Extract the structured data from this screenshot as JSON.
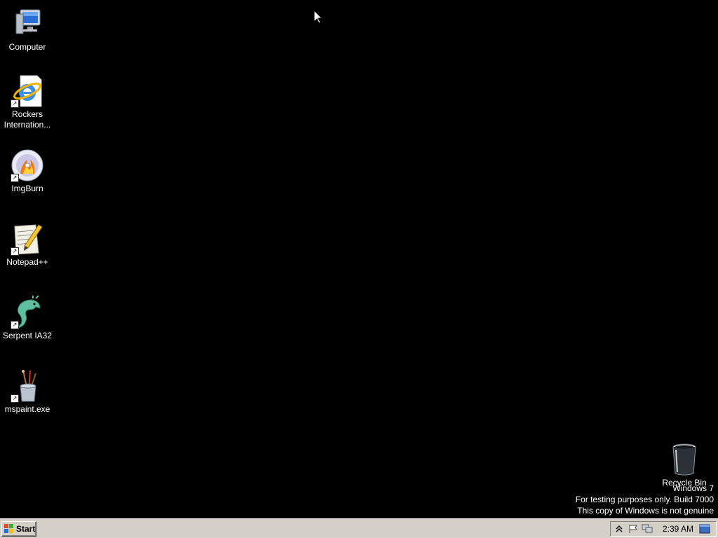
{
  "desktop": {
    "icons": [
      {
        "label": "Computer",
        "icon": "computer-icon"
      },
      {
        "label": "Rockers\nInternation...",
        "icon": "internet-explorer-icon"
      },
      {
        "label": "ImgBurn",
        "icon": "imgburn-icon"
      },
      {
        "label": "Notepad++",
        "icon": "notepad-plus-plus-icon"
      },
      {
        "label": "Serpent IA32",
        "icon": "serpent-icon"
      },
      {
        "label": "mspaint.exe",
        "icon": "mspaint-icon"
      }
    ],
    "recycle_bin": {
      "label": "Recycle Bin",
      "icon": "recycle-bin-icon"
    },
    "watermark": {
      "line1": "Windows 7",
      "line2": "For testing purposes only. Build 7000",
      "line3": "This copy of Windows is not genuine"
    }
  },
  "taskbar": {
    "start_label": "Start",
    "clock": "2:39 AM",
    "tray_icons": [
      "show-hidden-icons-chevron-icon",
      "action-center-flag-icon",
      "network-icon",
      "show-desktop-icon"
    ]
  },
  "colors": {
    "desktop_background": "#000000",
    "taskbar": "#d4d0c8"
  }
}
